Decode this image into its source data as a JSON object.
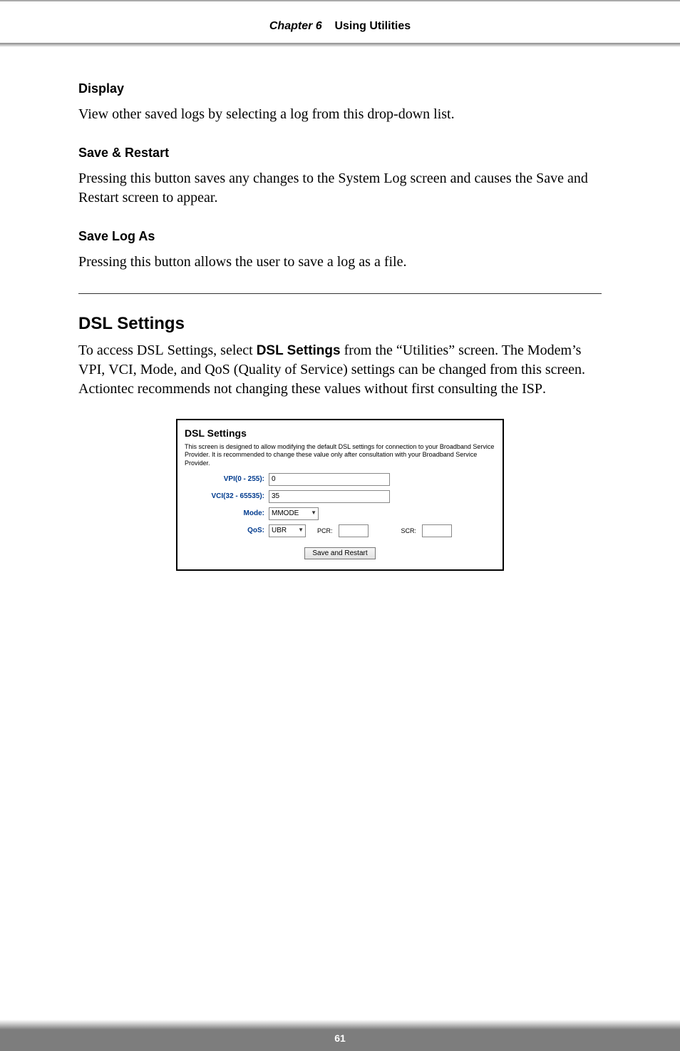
{
  "header": {
    "chapter": "Chapter 6",
    "title": "Using Utilities"
  },
  "display": {
    "heading": "Display",
    "body": "View other saved logs by selecting a log from this drop-down list."
  },
  "save_restart": {
    "heading": "Save & Restart",
    "body": "Pressing this button saves any changes to the System Log screen and causes the Save and Restart screen to appear."
  },
  "save_log_as": {
    "heading": "Save Log As",
    "body": "Pressing this button allows the user to save a log as a file."
  },
  "dsl": {
    "heading": "DSL Settings",
    "body_pre": "To access ",
    "body_dsl1": "DSL",
    "body_mid1": " Settings, select ",
    "body_bold": "DSL Settings",
    "body_mid2": " from the “Utilities” screen. The Modem’s ",
    "body_vpi": "VPI",
    "body_sep1": ", ",
    "body_vci": "VCI",
    "body_mid3": ", Mode, and QoS (Quality of Service) settings can be changed from this screen. Actiontec recommends not changing these values without first consulting the ",
    "body_isp": "ISP",
    "body_end": "."
  },
  "panel": {
    "title": "DSL Settings",
    "desc": "This screen is designed to allow modifying the default DSL settings for connection to your Broadband Service Provider. It is recommended to change these value only after consultation with your Broadband Service Provider.",
    "vpi_label": "VPI(0 - 255):",
    "vpi_value": "0",
    "vci_label": "VCI(32 - 65535):",
    "vci_value": "35",
    "mode_label": "Mode:",
    "mode_value": "MMODE",
    "qos_label": "QoS:",
    "qos_value": "UBR",
    "pcr_label": "PCR:",
    "pcr_value": "",
    "scr_label": "SCR:",
    "scr_value": "",
    "button": "Save and Restart"
  },
  "footer": {
    "page": "61"
  }
}
